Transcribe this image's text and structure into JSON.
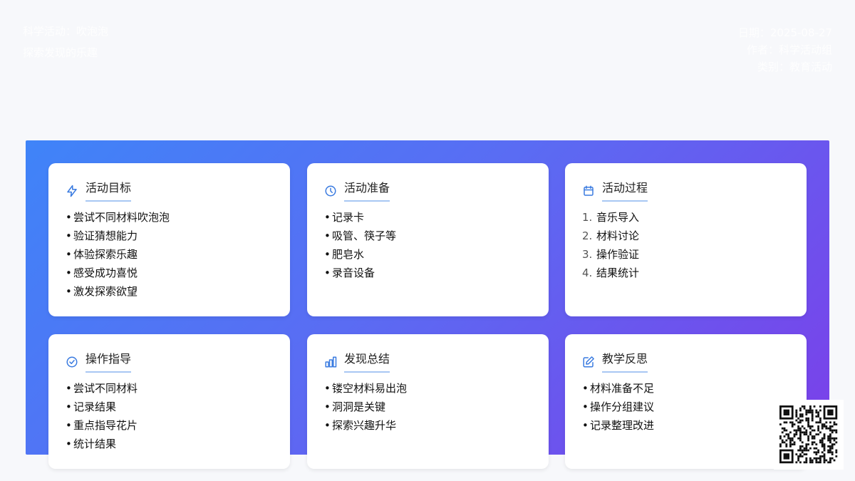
{
  "header": {
    "subtitle1": "科学活动：吹泡泡",
    "subtitle2": "探索发现的乐趣",
    "date": "日期：2025-08-27",
    "author": "作者：科学活动组",
    "category": "类别：教育活动"
  },
  "cards": [
    {
      "title": "活动目标",
      "icon": "lightning-icon",
      "list_style": "bullet",
      "items": [
        "尝试不同材料吹泡泡",
        "验证猜想能力",
        "体验探索乐趣",
        "感受成功喜悦",
        "激发探索欲望"
      ]
    },
    {
      "title": "活动准备",
      "icon": "clock-icon",
      "list_style": "bullet",
      "items": [
        "记录卡",
        "吸管、筷子等",
        "肥皂水",
        "录音设备"
      ]
    },
    {
      "title": "活动过程",
      "icon": "calendar-icon",
      "list_style": "numbered",
      "items": [
        "音乐导入",
        "材料讨论",
        "操作验证",
        "结果统计"
      ]
    },
    {
      "title": "操作指导",
      "icon": "check-circle-icon",
      "list_style": "bullet",
      "items": [
        "尝试不同材料",
        "记录结果",
        "重点指导花片",
        "统计结果"
      ]
    },
    {
      "title": "发现总结",
      "icon": "bar-chart-icon",
      "list_style": "bullet",
      "items": [
        "镂空材料易出泡",
        "洞洞是关键",
        "探索兴趣升华"
      ]
    },
    {
      "title": "教学反思",
      "icon": "edit-icon",
      "list_style": "bullet",
      "items": [
        "材料准备不足",
        "操作分组建议",
        "记录整理改进"
      ]
    }
  ],
  "colors": {
    "gradient_start": "#3f84f8",
    "gradient_end": "#7b3fe9",
    "icon": "#3a7be0",
    "title_underline": "#a8c7f3"
  },
  "qr_code": {
    "icon": "qr-code-icon"
  }
}
